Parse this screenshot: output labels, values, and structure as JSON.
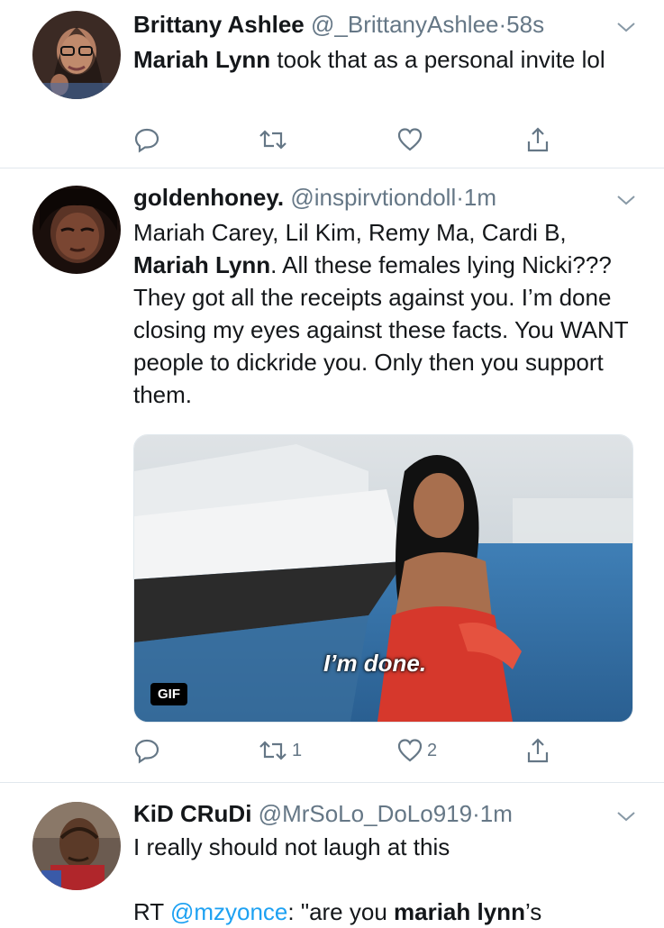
{
  "tweets": [
    {
      "name": "Brittany Ashlee",
      "handle": "@_BrittanyAshlee",
      "dot": "·",
      "time": "58s",
      "text_mention": "Mariah Lynn",
      "text_rest": " took that as a personal invite lol",
      "retweets": "",
      "likes": ""
    },
    {
      "name": "goldenhoney.",
      "handle": "@inspirvtiondoll",
      "dot": "·",
      "time": "1m",
      "text_pre": "Mariah Carey, Lil Kim, Remy Ma, Cardi B, ",
      "text_mention": "Mariah Lynn",
      "text_rest": ". All these females lying Nicki??? They got all the receipts against you. I’m done closing my eyes against these facts. You WANT people to dickride you. Only then you support them.",
      "gif_badge": "GIF",
      "gif_caption": "I’m done.",
      "retweets": "1",
      "likes": "2"
    },
    {
      "name": "KiD CRuDi",
      "handle": "@MrSoLo_DoLo919",
      "dot": "·",
      "time": "1m",
      "text_line1": "I really should not laugh at this",
      "rt_prefix": "RT ",
      "rt_mention": "@mzyonce",
      "rt_text": ": \"are you ",
      "rt_bold": "mariah lynn",
      "rt_end": "’s"
    }
  ],
  "icons": {
    "reply": "reply-icon",
    "retweet": "retweet-icon",
    "like": "heart-icon",
    "share": "share-icon",
    "caret": "chevron-down-icon"
  },
  "colors": {
    "text": "#14171a",
    "secondary": "#657786",
    "link": "#1da1f2",
    "divider": "#e1e8ed"
  }
}
